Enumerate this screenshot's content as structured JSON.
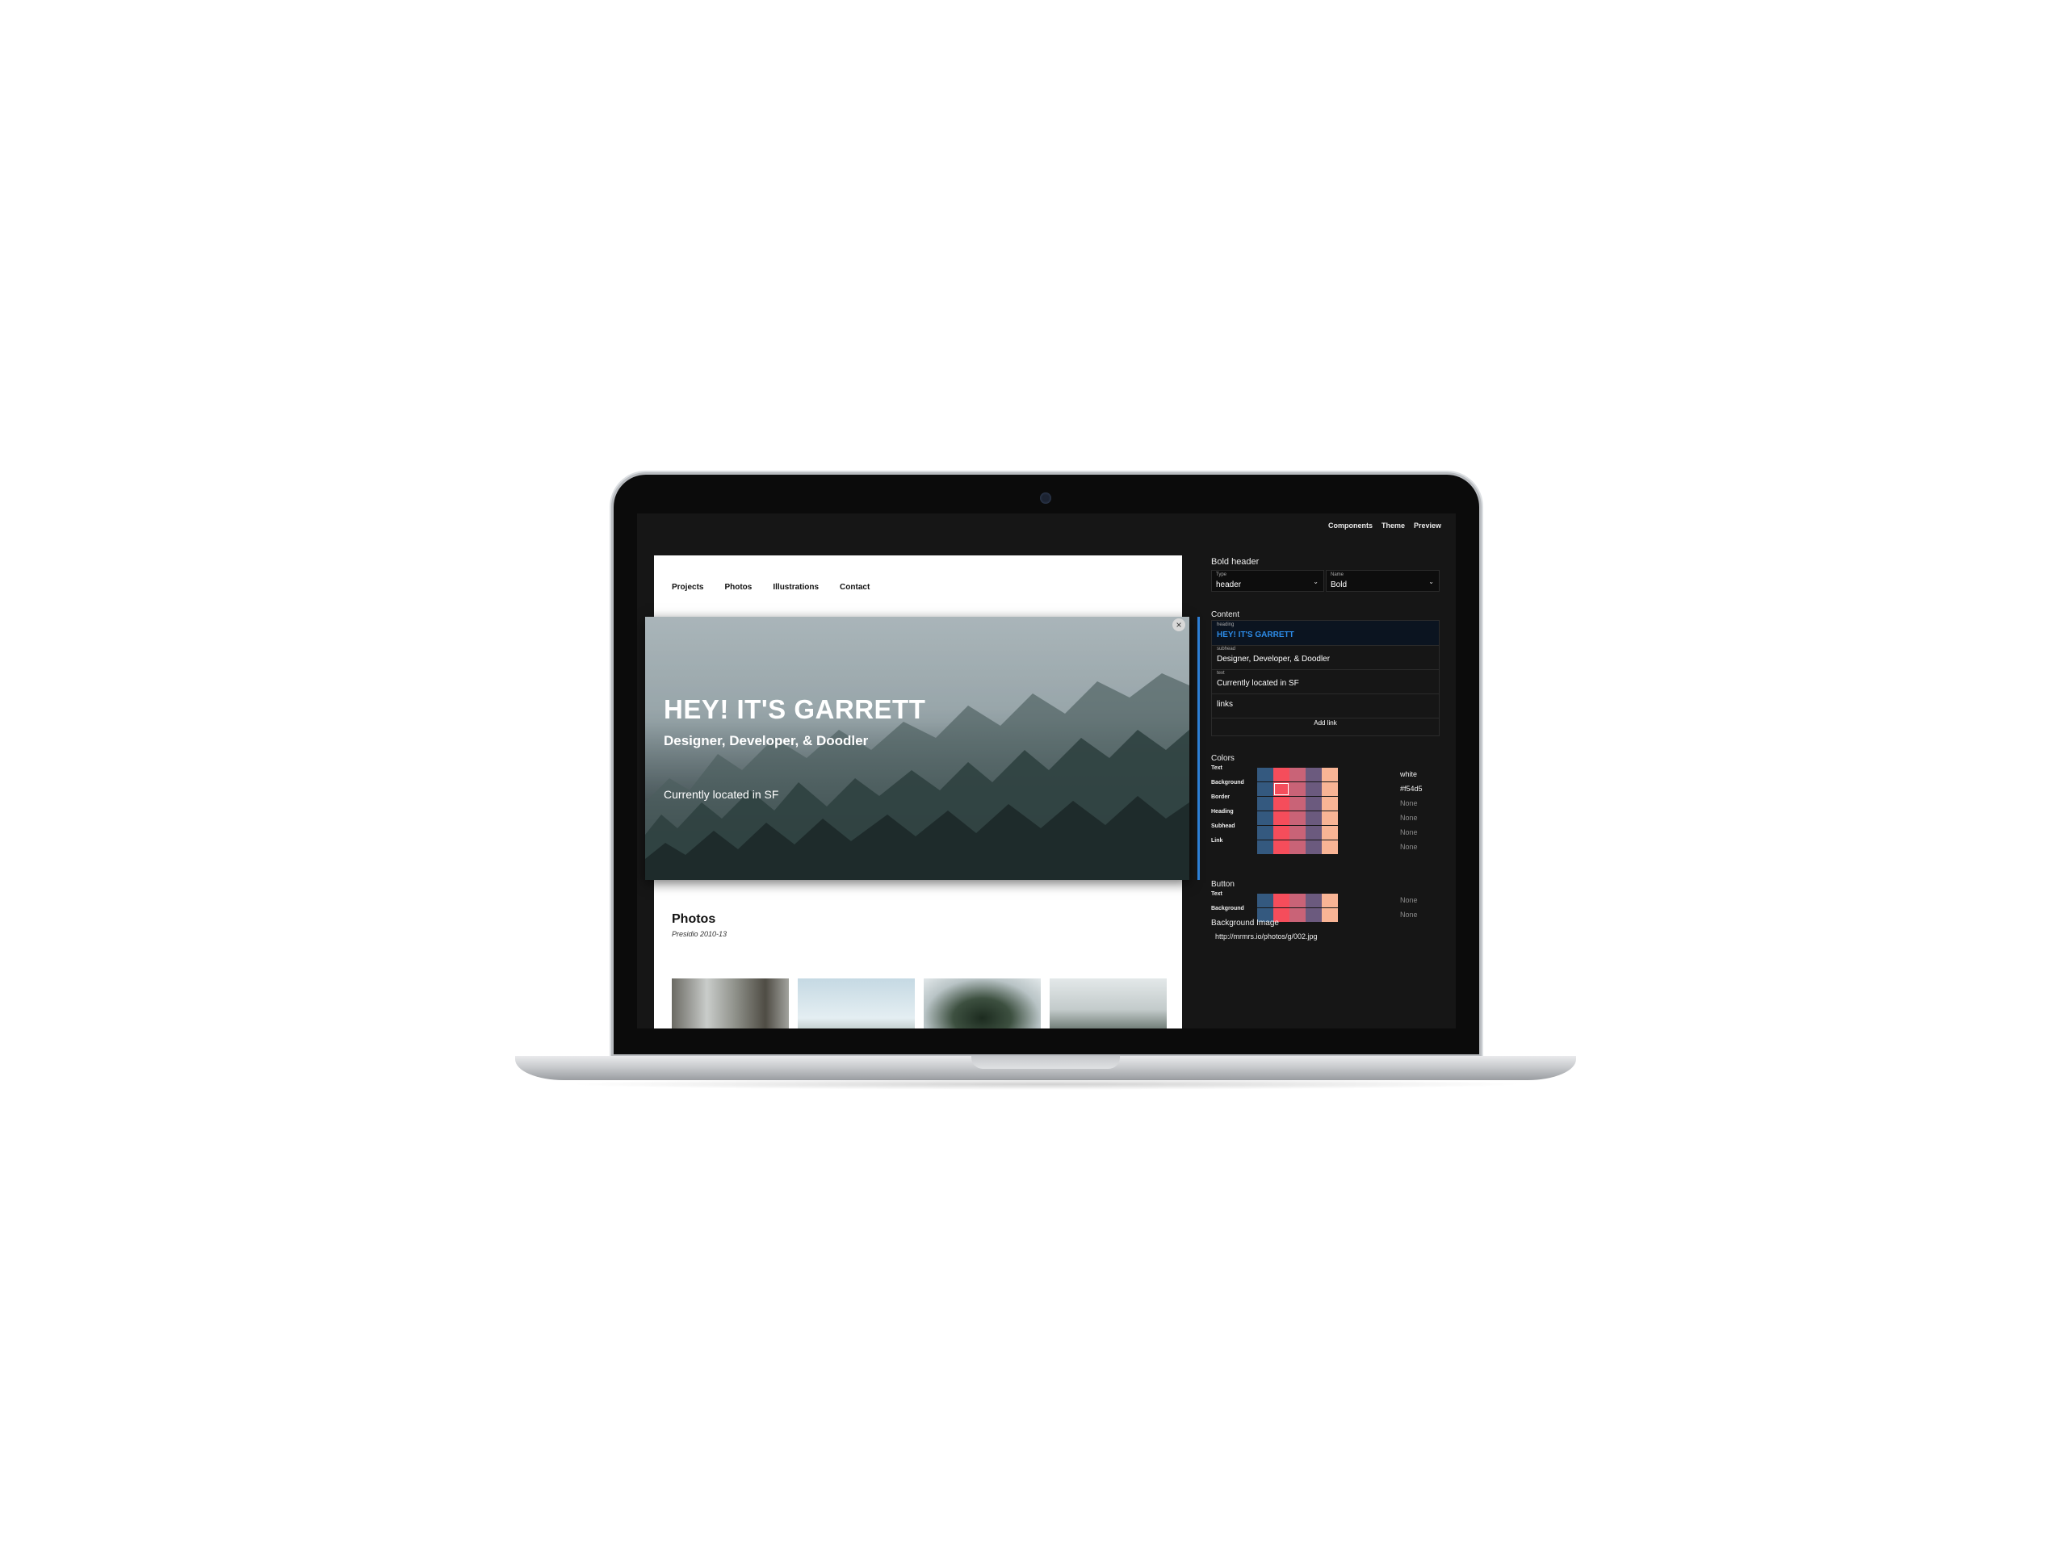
{
  "topnav": [
    "Components",
    "Theme",
    "Preview"
  ],
  "site_nav": [
    "Projects",
    "Photos",
    "Illustrations",
    "Contact"
  ],
  "hero": {
    "heading": "HEY! IT'S GARRETT",
    "subhead": "Designer, Developer, & Doodler",
    "text": "Currently located in SF",
    "close_glyph": "×"
  },
  "photos": {
    "title": "Photos",
    "subtitle": "Presidio 2010-13"
  },
  "panel": {
    "title": "Bold header",
    "type": {
      "label": "Type",
      "value": "header",
      "chevron": "⌄"
    },
    "name": {
      "label": "Name",
      "value": "Bold",
      "chevron": "⌄"
    },
    "content_label": "Content",
    "fields": [
      {
        "label": "heading",
        "value": "HEY! IT'S GARRETT"
      },
      {
        "label": "subhead",
        "value": "Designer, Developer, & Doodler"
      },
      {
        "label": "text",
        "value": "Currently located in SF"
      },
      {
        "label": "",
        "value": "links"
      }
    ],
    "add_link": "Add link",
    "colors_label": "Colors",
    "palette": [
      "#34597f",
      "#f54d5b",
      "#c96377",
      "#6b5a7e",
      "#f8b495"
    ],
    "color_rows": [
      {
        "label": "Text",
        "value": "white",
        "none": false,
        "selected": -1
      },
      {
        "label": "Background",
        "value": "#f54d5",
        "none": false,
        "selected": 1
      },
      {
        "label": "Border",
        "value": "None",
        "none": true,
        "selected": -1
      },
      {
        "label": "Heading",
        "value": "None",
        "none": true,
        "selected": -1
      },
      {
        "label": "Subhead",
        "value": "None",
        "none": true,
        "selected": -1
      },
      {
        "label": "Link",
        "value": "None",
        "none": true,
        "selected": -1
      }
    ],
    "button_label": "Button",
    "button_rows": [
      {
        "label": "Text",
        "value": "None",
        "none": true
      },
      {
        "label": "Background",
        "value": "None",
        "none": true
      }
    ],
    "bg_image_label": "Background Image",
    "bg_image_url": "http://mrmrs.io/photos/g/002.jpg"
  }
}
